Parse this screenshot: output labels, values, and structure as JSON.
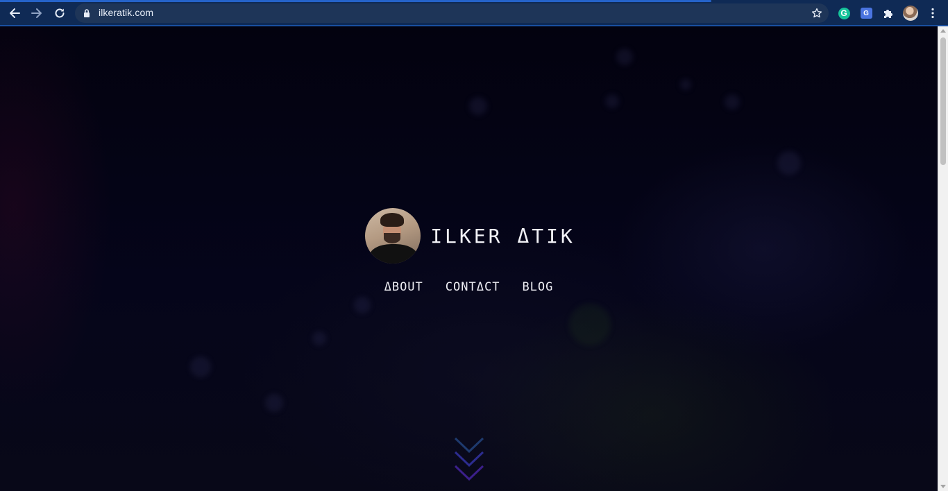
{
  "browser": {
    "url": "ilkeratik.com",
    "load_progress": 0.75,
    "icons": {
      "back": "arrow-left-icon",
      "forward": "arrow-right-icon",
      "reload": "reload-icon",
      "lock": "lock-icon",
      "bookmark": "star-icon",
      "extension_grammarly": "grammarly-icon",
      "extension_translate": "translate-icon",
      "extensions": "puzzle-icon",
      "profile": "avatar",
      "menu": "kebab-menu-icon"
    },
    "extension_grammarly_letter": "G",
    "extension_translate_letter": "G",
    "colors": {
      "toolbar": "#0f2a55",
      "omnibox": "#1e3558",
      "accent": "#2563c9"
    }
  },
  "page": {
    "title": "ILKER ΔTIK",
    "nav": [
      {
        "label": "ΔBOUT"
      },
      {
        "label": "CONTΔCT"
      },
      {
        "label": "BLOG"
      }
    ],
    "colors": {
      "background": "#03020f",
      "text": "#f2f2f7",
      "chevron_top": "#1e3a6e",
      "chevron_mid": "#2c2c8f",
      "chevron_bottom": "#3b1f8a"
    }
  }
}
